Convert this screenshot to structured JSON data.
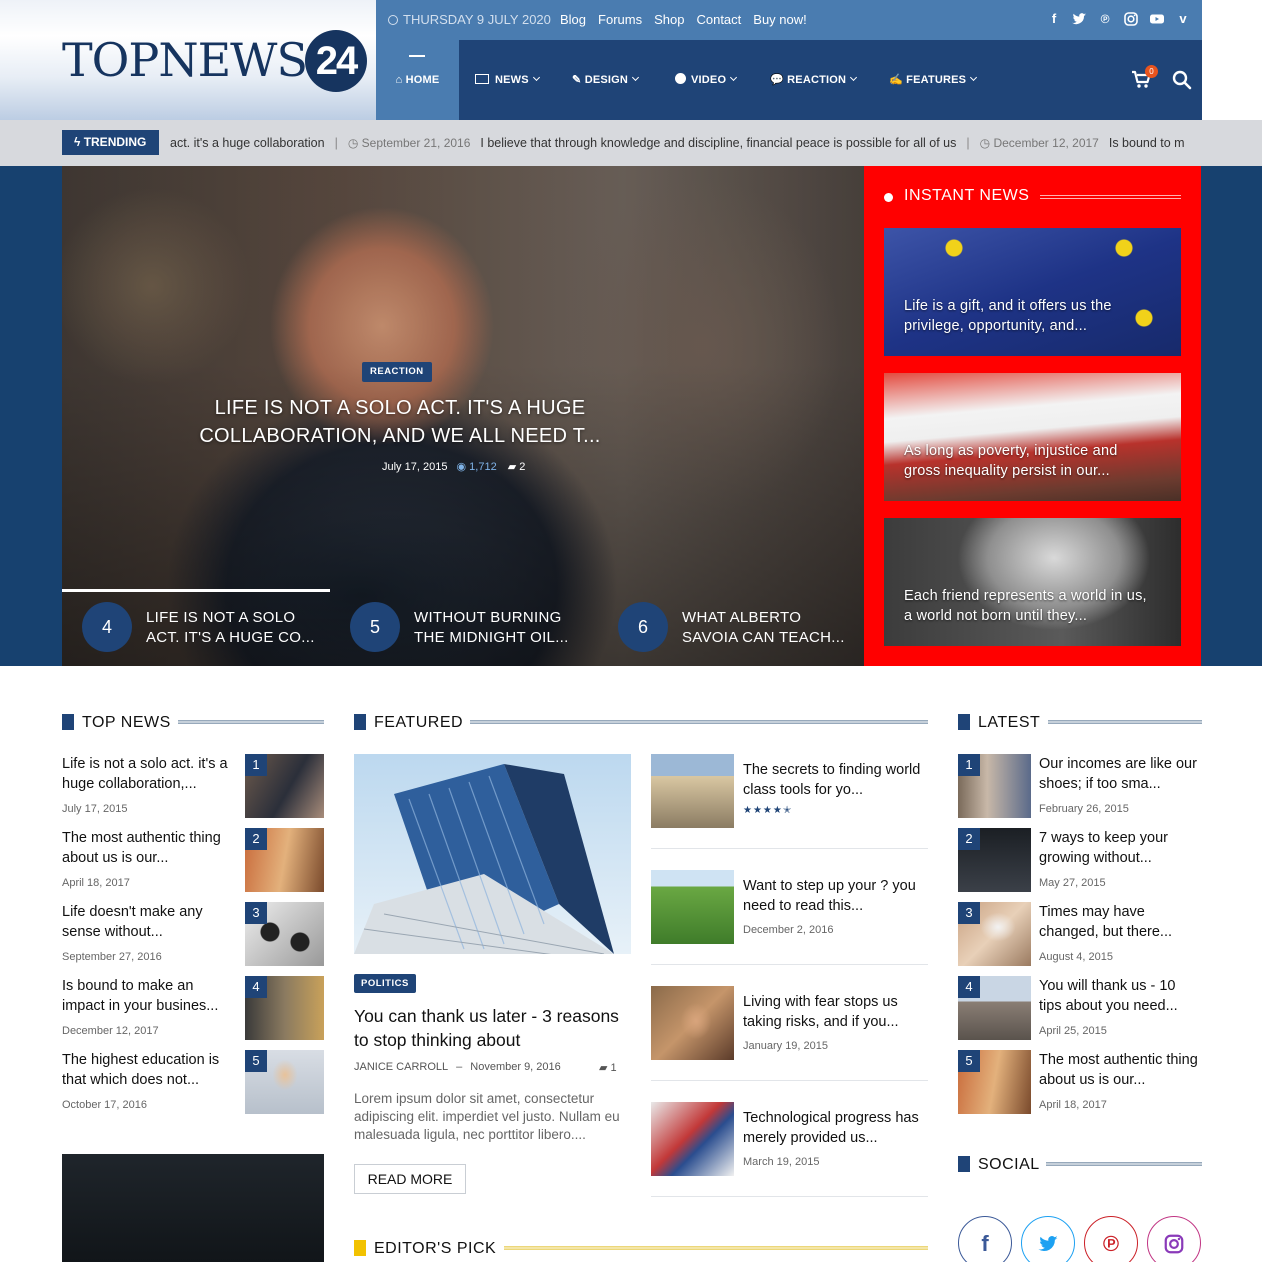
{
  "header": {
    "logo_text": "TOPNEWS",
    "logo_num": "24",
    "date": "THURSDAY 9 JULY 2020",
    "links": [
      "Blog",
      "Forums",
      "Shop",
      "Contact",
      "Buy now!"
    ],
    "social_icons": [
      "facebook-icon",
      "twitter-icon",
      "pinterest-icon",
      "instagram-icon",
      "youtube-icon",
      "vimeo-icon"
    ],
    "nav": [
      "HOME",
      "NEWS",
      "DESIGN",
      "VIDEO",
      "REACTION",
      "FEATURES"
    ],
    "cart_count": "0"
  },
  "trending": {
    "label": "TRENDING",
    "items": [
      {
        "text": "act. it's a huge collaboration"
      },
      {
        "date": "September 21, 2016",
        "text": "I believe that through knowledge and discipline, financial peace is possible for all of us"
      },
      {
        "date": "December 12, 2017",
        "text": "Is bound to m"
      }
    ]
  },
  "hero": {
    "category": "REACTION",
    "title": "LIFE IS NOT A SOLO ACT. IT'S A HUGE COLLABORATION, AND WE ALL NEED T...",
    "date": "July 17, 2015",
    "views": "1,712",
    "comments": "2",
    "slides": [
      {
        "num": "4",
        "title": "LIFE IS NOT A SOLO ACT. IT'S A HUGE CO..."
      },
      {
        "num": "5",
        "title": "WITHOUT BURNING THE MIDNIGHT OIL..."
      },
      {
        "num": "6",
        "title": "WHAT ALBERTO SAVOIA CAN TEACH..."
      }
    ]
  },
  "instant": {
    "title": "INSTANT NEWS",
    "items": [
      {
        "title": "Life is a gift, and it offers us the privilege, opportunity, and..."
      },
      {
        "title": "As long as poverty, injustice and gross inequality persist in our..."
      },
      {
        "title": "Each friend represents a world in us, a world not born until they..."
      }
    ]
  },
  "top_news": {
    "title": "TOP NEWS",
    "items": [
      {
        "num": "1",
        "title": "Life is not a solo act. it's a huge collaboration,...",
        "date": "July 17, 2015"
      },
      {
        "num": "2",
        "title": "The most authentic thing about us is our...",
        "date": "April 18, 2017"
      },
      {
        "num": "3",
        "title": "Life doesn't make any sense without...",
        "date": "September 27, 2016"
      },
      {
        "num": "4",
        "title": "Is bound to make an impact in your busines...",
        "date": "December 12, 2017"
      },
      {
        "num": "5",
        "title": "The highest education is that which does not...",
        "date": "October 17, 2016"
      }
    ]
  },
  "featured": {
    "title": "FEATURED",
    "main": {
      "category": "POLITICS",
      "title": "You can thank us later - 3 reasons to stop thinking about",
      "author": "JANICE CARROLL",
      "date": "November 9, 2016",
      "comments": "1",
      "excerpt": "Lorem ipsum dolor sit amet, consectetur adipiscing elit. imperdiet vel justo. Nullam eu malesuada ligula, nec porttitor libero....",
      "read_more": "READ MORE"
    },
    "items": [
      {
        "title": "The secrets to finding world class tools for yo...",
        "rating": 4.5
      },
      {
        "title": "Want to step up your ? you need to read this...",
        "date": "December 2, 2016"
      },
      {
        "title": "Living with fear stops us taking risks, and if you...",
        "date": "January 19, 2015"
      },
      {
        "title": "Technological progress has merely provided us...",
        "date": "March 19, 2015"
      }
    ]
  },
  "editors_pick": {
    "title": "EDITOR'S PICK"
  },
  "latest": {
    "title": "LATEST",
    "items": [
      {
        "num": "1",
        "title": "Our incomes are like our shoes; if too sma...",
        "date": "February 26, 2015"
      },
      {
        "num": "2",
        "title": "7 ways to keep your growing without...",
        "date": "May 27, 2015"
      },
      {
        "num": "3",
        "title": "Times may have changed, but there...",
        "date": "August 4, 2015"
      },
      {
        "num": "4",
        "title": "You will thank us - 10 tips about you need...",
        "date": "April 25, 2015"
      },
      {
        "num": "5",
        "title": "The most authentic thing about us is our...",
        "date": "April 18, 2017"
      }
    ]
  },
  "social": {
    "title": "SOCIAL",
    "icons": [
      "facebook-icon",
      "twitter-icon",
      "pinterest-icon",
      "instagram-icon"
    ]
  },
  "colors": {
    "brand": "#1f4477",
    "accent": "#4a7cb0",
    "instant": "#ff0000",
    "editors": "#f2c200"
  }
}
